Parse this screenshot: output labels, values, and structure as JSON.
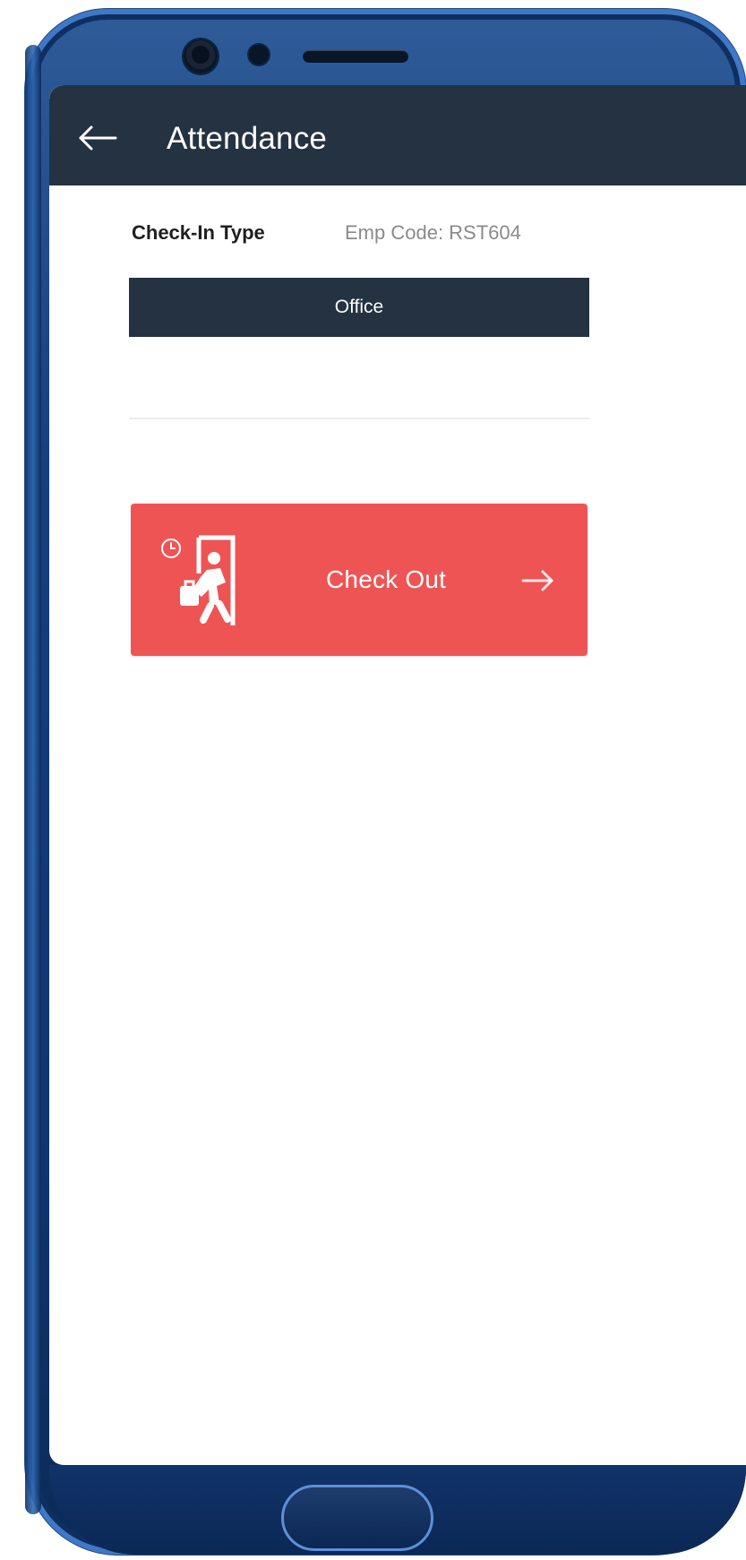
{
  "app": {
    "title": "Attendance"
  },
  "header": {
    "check_in_type_label": "Check-In Type",
    "emp_code_text": "Emp Code: RST604"
  },
  "check_in": {
    "selected_type": "Office"
  },
  "actions": {
    "check_out_label": "Check Out"
  },
  "icons": {
    "back": "arrow-left-icon",
    "check_out_illustration": "walking-out-door-icon",
    "check_out_arrow": "arrow-right-icon",
    "clock": "clock-icon"
  },
  "colors": {
    "header_bg": "#243241",
    "office_bg": "#243241",
    "check_out_bg": "#ef5454",
    "phone_blue": "#163f7c"
  }
}
